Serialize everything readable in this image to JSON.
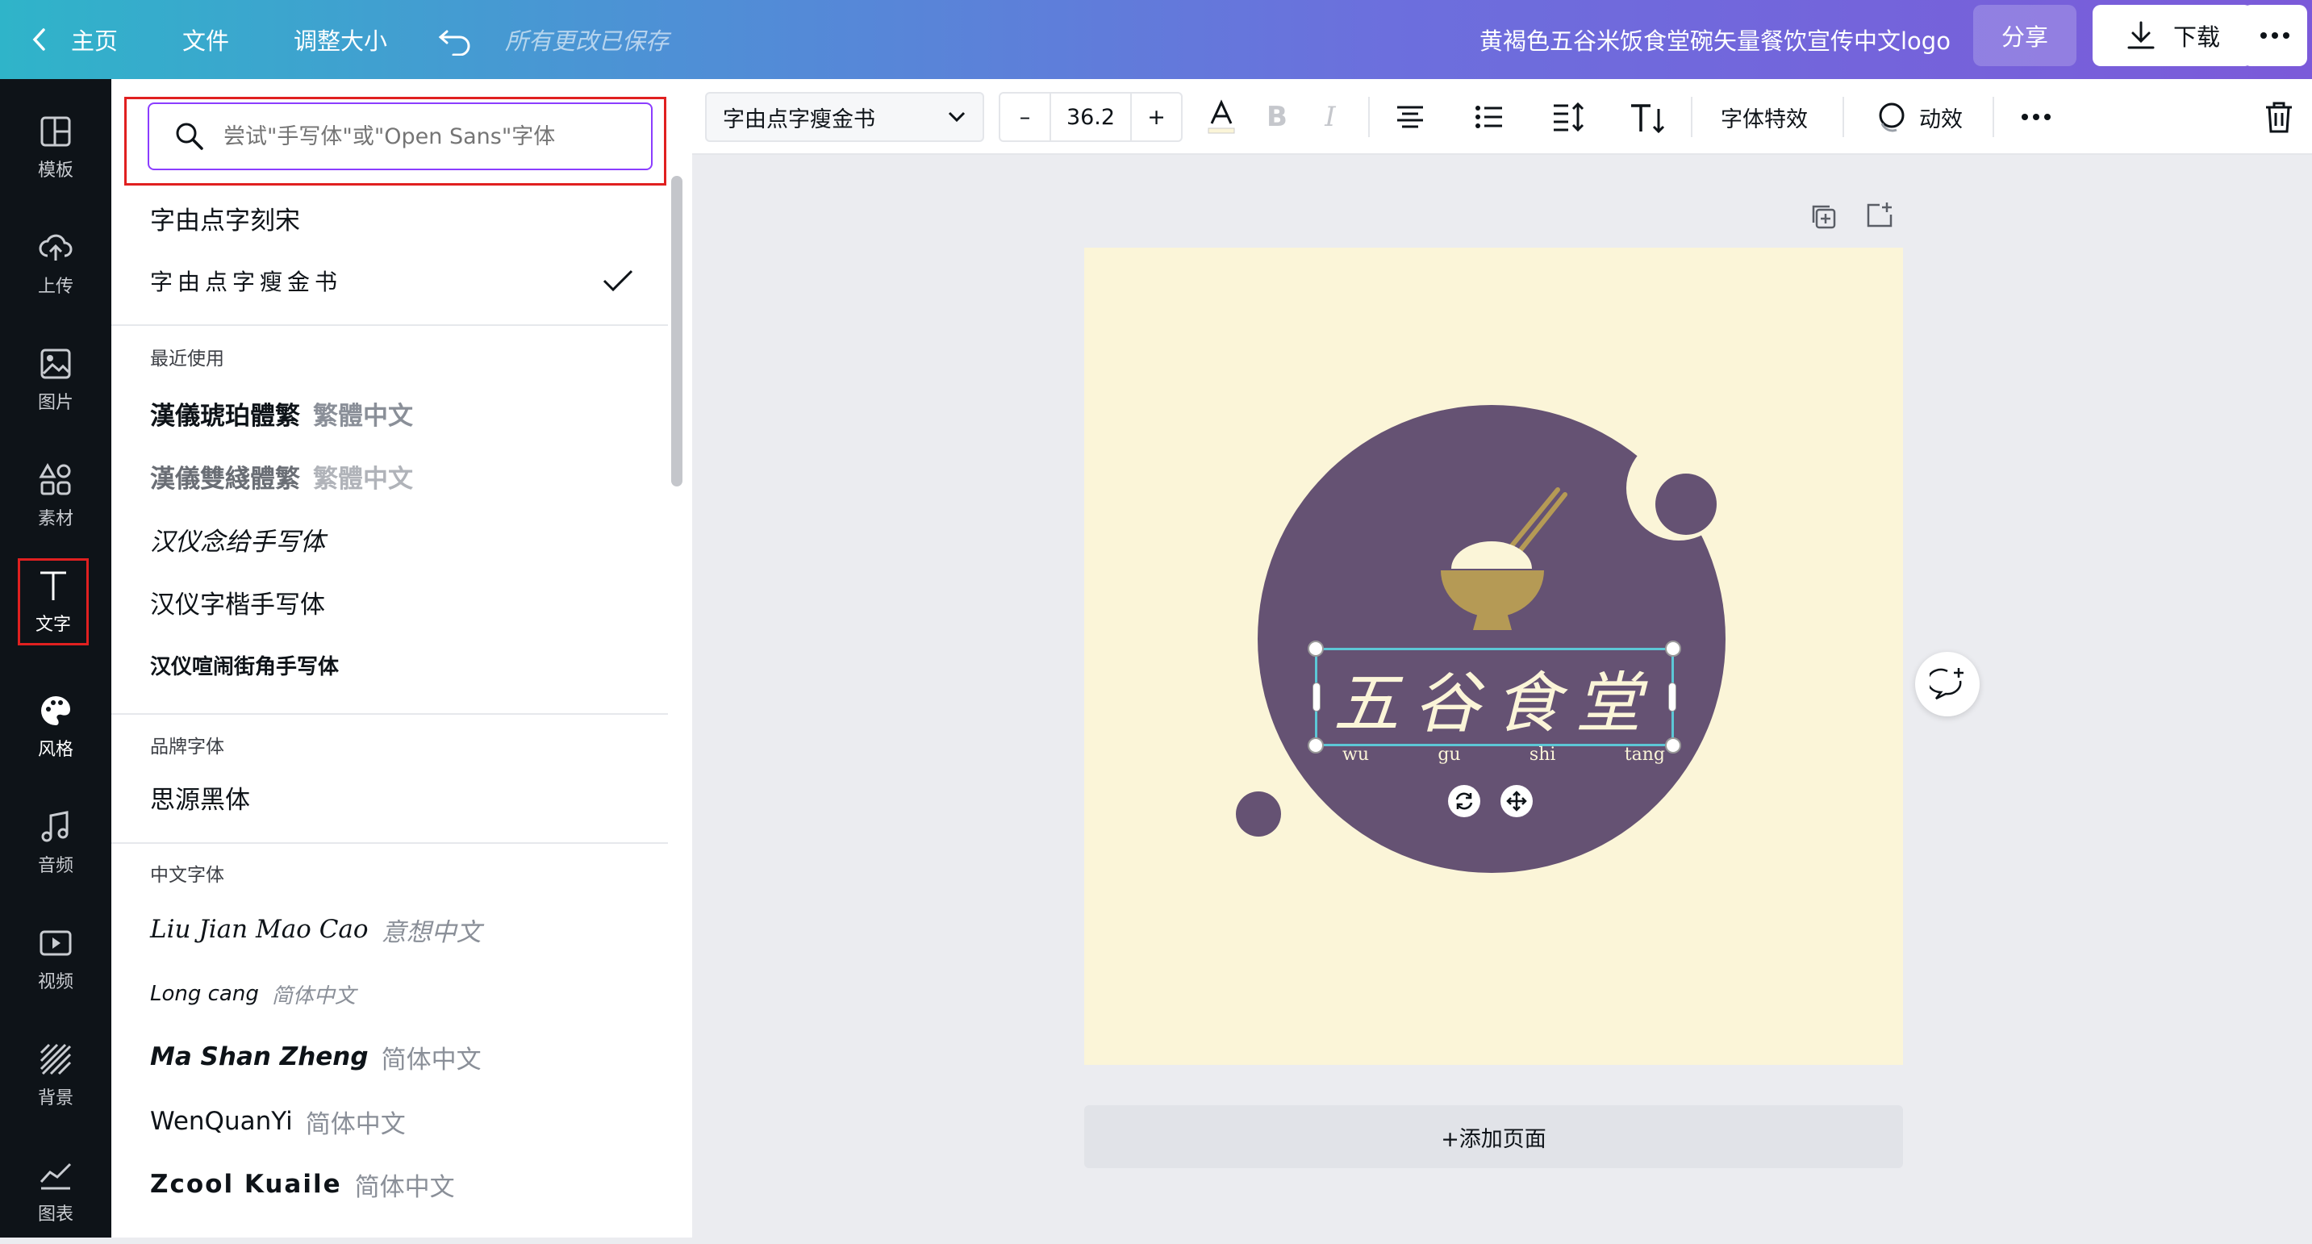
{
  "topbar": {
    "home": "主页",
    "file": "文件",
    "resize": "调整大小",
    "saved_status": "所有更改已保存",
    "doc_title": "黄褐色五谷米饭食堂碗矢量餐饮宣传中文logo",
    "share": "分享",
    "download": "下载"
  },
  "rail": {
    "items": [
      {
        "label": "模板",
        "icon": "template-icon"
      },
      {
        "label": "上传",
        "icon": "upload-cloud-icon"
      },
      {
        "label": "图片",
        "icon": "image-icon"
      },
      {
        "label": "素材",
        "icon": "elements-icon"
      },
      {
        "label": "文字",
        "icon": "text-icon"
      },
      {
        "label": "风格",
        "icon": "palette-icon"
      },
      {
        "label": "音频",
        "icon": "music-note-icon"
      },
      {
        "label": "视频",
        "icon": "video-icon"
      },
      {
        "label": "背景",
        "icon": "background-pattern-icon"
      },
      {
        "label": "图表",
        "icon": "chart-icon"
      }
    ]
  },
  "panel": {
    "search_placeholder": "尝试\"手写体\"或\"Open Sans\"字体",
    "top_fonts": [
      "字由点字刻宋",
      "字由点字瘦金书"
    ],
    "recent_label": "最近使用",
    "recent": [
      {
        "name": "漢儀琥珀體繁",
        "sample": "繁體中文"
      },
      {
        "name": "漢儀雙綫體繁",
        "sample": "繁體中文"
      },
      {
        "name": "汉仪念给手写体",
        "sample": ""
      },
      {
        "name": "汉仪字楷手写体",
        "sample": ""
      },
      {
        "name": "汉仪喧闹街角手写体",
        "sample": ""
      }
    ],
    "brand_label": "品牌字体",
    "brand": [
      "思源黑体"
    ],
    "chinese_label": "中文字体",
    "chinese": [
      {
        "name": "Liu Jian Mao Cao",
        "sample": "意想中文"
      },
      {
        "name": "Long cang",
        "sample": "简体中文"
      },
      {
        "name": "Ma Shan Zheng",
        "sample": "简体中文"
      },
      {
        "name": "WenQuanYi",
        "sample": "简体中文"
      },
      {
        "name": "Zcool Kuaile",
        "sample": "简体中文"
      }
    ]
  },
  "toolbar": {
    "font_name": "字由点字瘦金书",
    "minus": "–",
    "font_size": "36.2",
    "plus": "+",
    "text_effects": "字体特效",
    "animate": "动效"
  },
  "design": {
    "title": "五谷食堂",
    "pinyin": [
      "wu",
      "gu",
      "shi",
      "tang"
    ],
    "colors": {
      "background": "#fbf5d8",
      "circle": "#655273",
      "bowl": "#b59a55",
      "rice": "#fbf5d8"
    }
  },
  "add_page": "+添加页面"
}
